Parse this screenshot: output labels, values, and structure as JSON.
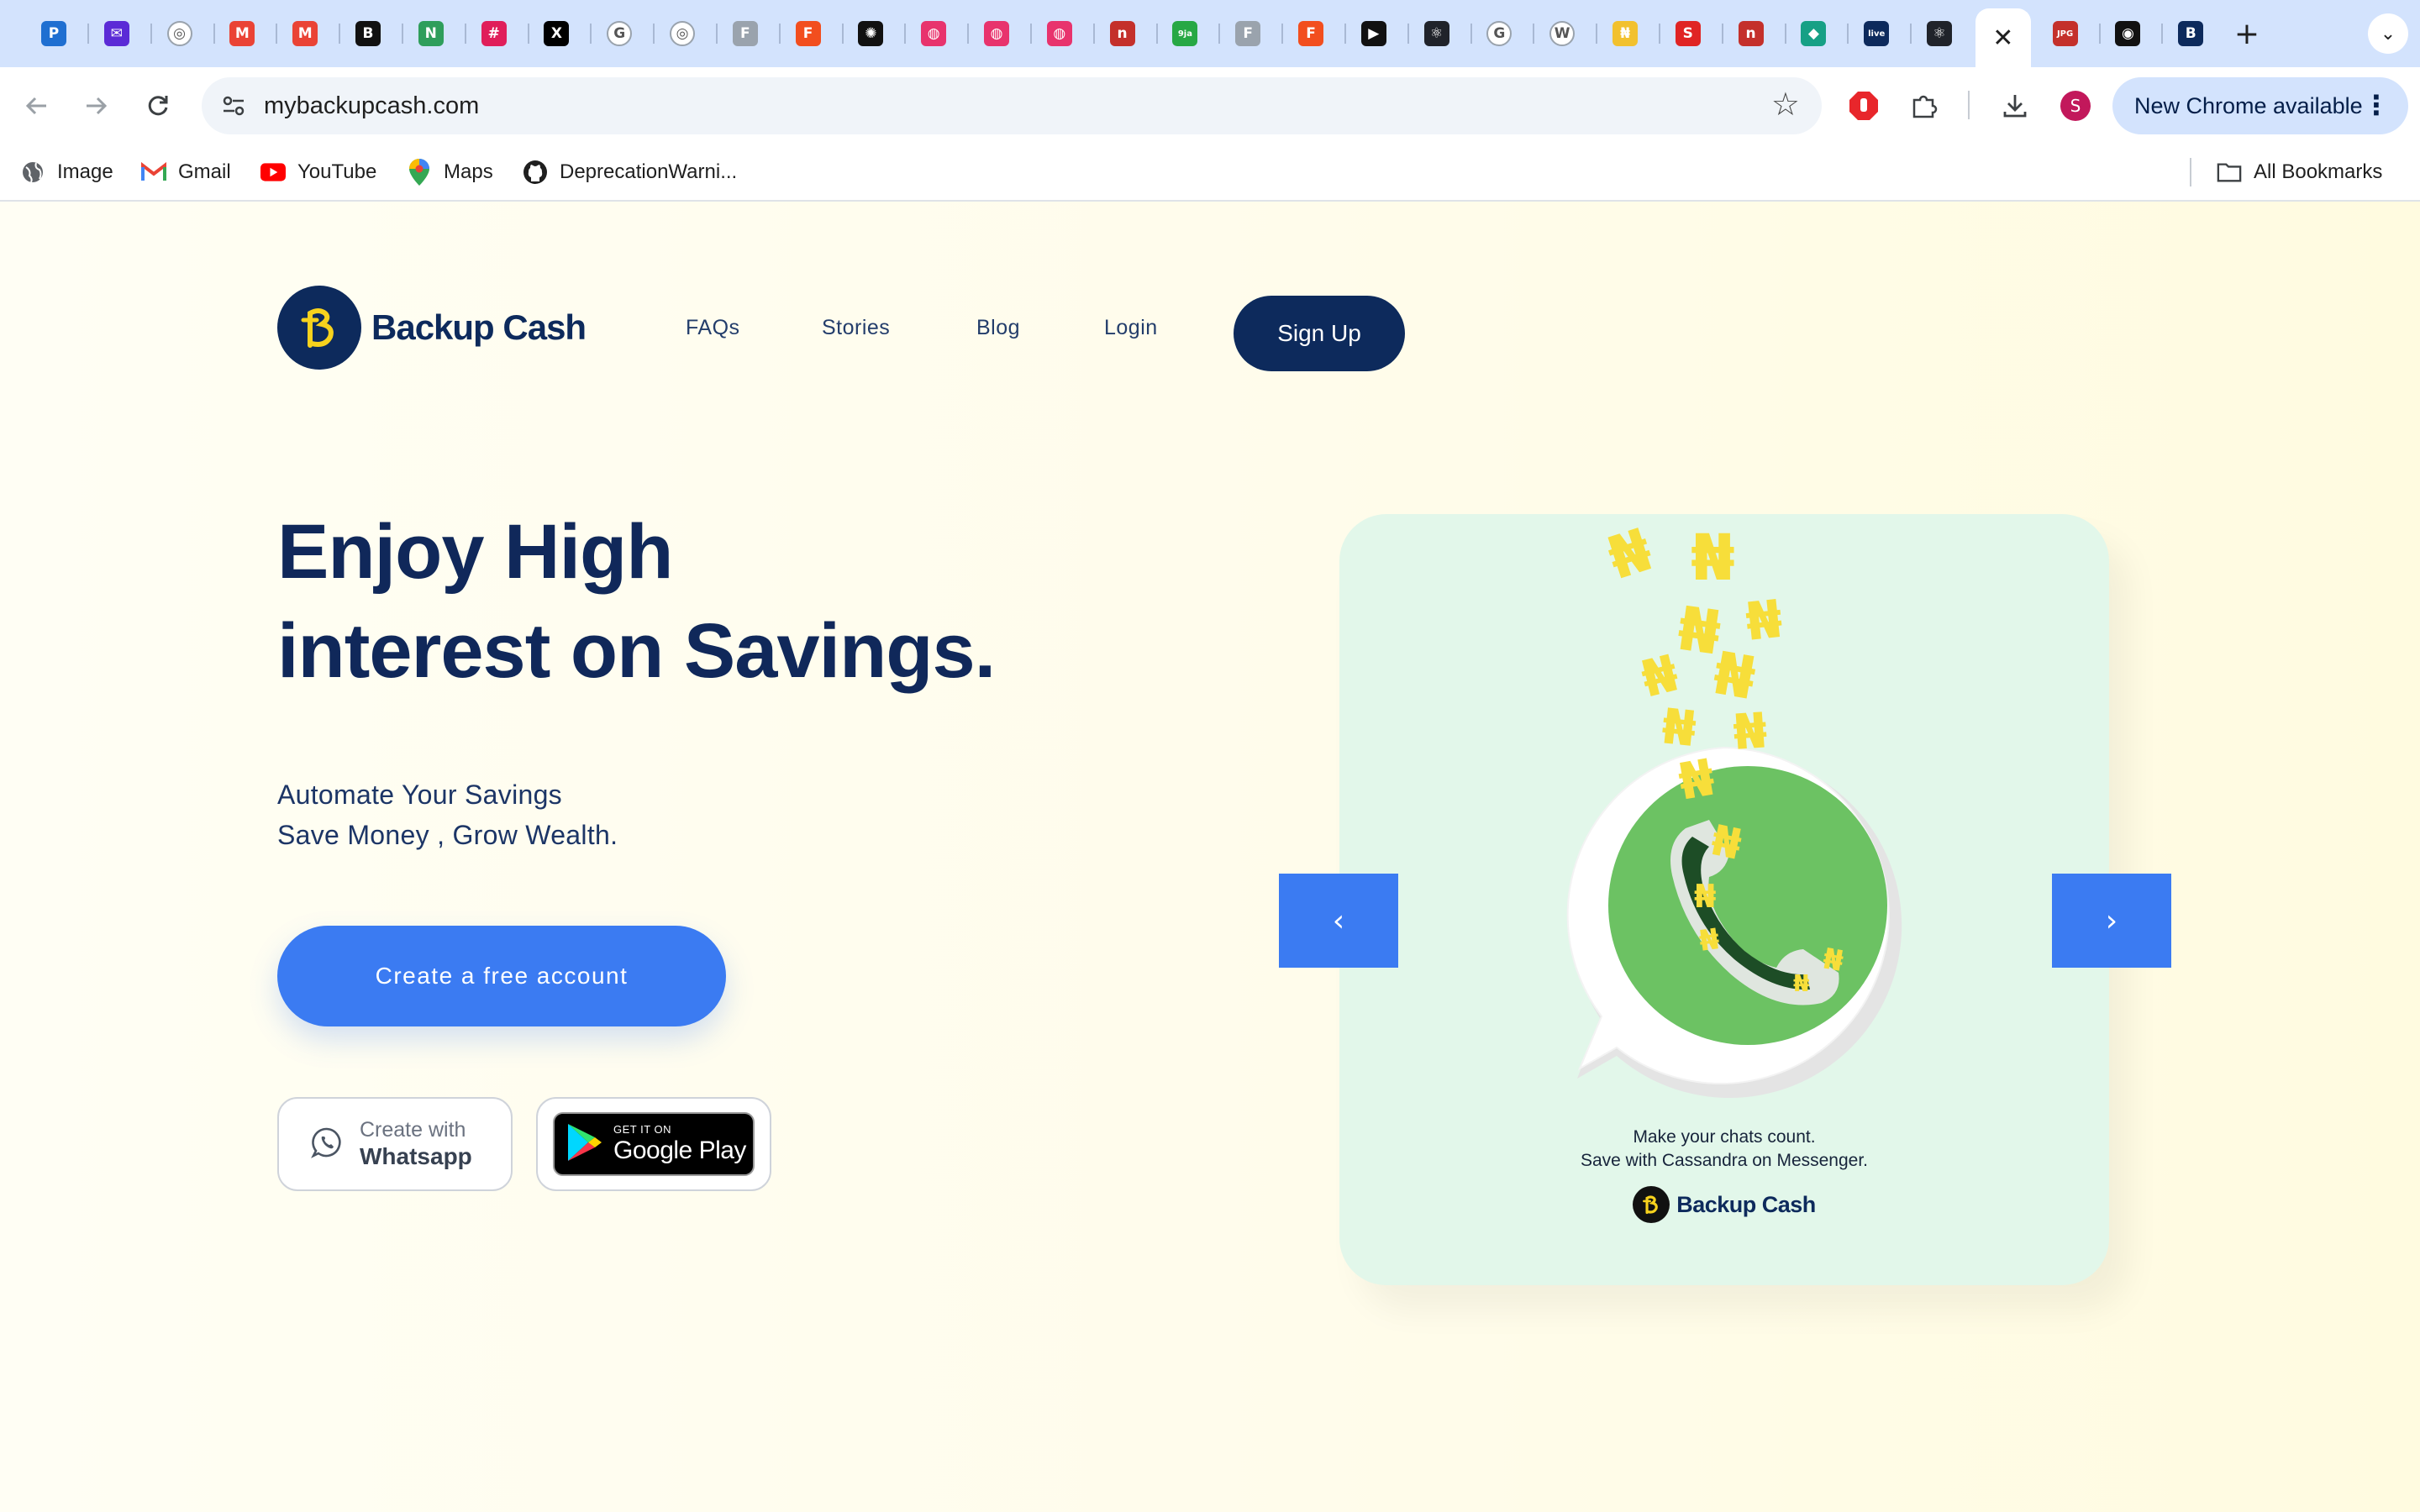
{
  "browser": {
    "tabs": [
      {
        "icon": "pocket-icon",
        "glyph": "P",
        "color": "#1f6fd1"
      },
      {
        "icon": "mail-icon",
        "glyph": "✉",
        "color": "#5b2bd6"
      },
      {
        "icon": "globe-icon",
        "glyph": "◎",
        "color": "#9aa3ad"
      },
      {
        "icon": "gmail-icon",
        "glyph": "M",
        "color": "#ea4335"
      },
      {
        "icon": "gmail-icon",
        "glyph": "M",
        "color": "#ea4335"
      },
      {
        "icon": "b-icon",
        "glyph": "B",
        "color": "#111111"
      },
      {
        "icon": "green-circle-icon",
        "glyph": "N",
        "color": "#2e9e5b"
      },
      {
        "icon": "slack-icon",
        "glyph": "#",
        "color": "#e01e5a"
      },
      {
        "icon": "x-icon",
        "glyph": "X",
        "color": "#000000"
      },
      {
        "icon": "google-icon",
        "glyph": "G",
        "color": "#9aa3ad"
      },
      {
        "icon": "globe-icon",
        "glyph": "◎",
        "color": "#9aa3ad"
      },
      {
        "icon": "figma-icon",
        "glyph": "F",
        "color": "#9aa3ad"
      },
      {
        "icon": "figma-icon",
        "glyph": "F",
        "color": "#f24e1e"
      },
      {
        "icon": "chatgpt-icon",
        "glyph": "✺",
        "color": "#111111"
      },
      {
        "icon": "dribbble-icon",
        "glyph": "◍",
        "color": "#e8336d"
      },
      {
        "icon": "dribbble-icon",
        "glyph": "◍",
        "color": "#e8336d"
      },
      {
        "icon": "dribbble-icon",
        "glyph": "◍",
        "color": "#e8336d"
      },
      {
        "icon": "n-icon",
        "glyph": "n",
        "color": "#c4302b"
      },
      {
        "icon": "naija-icon",
        "glyph": "9ja",
        "color": "#27a844"
      },
      {
        "icon": "figma-icon",
        "glyph": "F",
        "color": "#9aa3ad"
      },
      {
        "icon": "figma-icon",
        "glyph": "F",
        "color": "#f24e1e"
      },
      {
        "icon": "play-icon",
        "glyph": "▶",
        "color": "#111111"
      },
      {
        "icon": "react-icon",
        "glyph": "⚛",
        "color": "#20232a"
      },
      {
        "icon": "google-icon",
        "glyph": "G",
        "color": "#9aa3ad"
      },
      {
        "icon": "wikipedia-icon",
        "glyph": "W",
        "color": "#9aa3ad"
      },
      {
        "icon": "bank-icon",
        "glyph": "₦",
        "color": "#f2c12e"
      },
      {
        "icon": "s-icon",
        "glyph": "S",
        "color": "#e02424"
      },
      {
        "icon": "n-icon",
        "glyph": "n",
        "color": "#c4302b"
      },
      {
        "icon": "diamond-icon",
        "glyph": "◆",
        "color": "#16a085"
      },
      {
        "icon": "live-icon",
        "glyph": "live",
        "color": "#0d2a5c"
      },
      {
        "icon": "react-icon",
        "glyph": "⚛",
        "color": "#20232a"
      },
      {
        "icon": "active-tab-close-icon",
        "glyph": "✕",
        "color": "#ffffff",
        "active": true
      },
      {
        "icon": "jpg-png-icon",
        "glyph": "JPG",
        "color": "#c4302b"
      },
      {
        "icon": "github-icon",
        "glyph": "◉",
        "color": "#111111"
      },
      {
        "icon": "backup-cash-icon",
        "glyph": "B",
        "color": "#0d2a5c"
      }
    ],
    "new_tab": "+",
    "tab_search": "⌄",
    "url": "mybackupcash.com",
    "star": "☆",
    "profile_initial": "S",
    "update_label": "New Chrome available",
    "update_menu": "⋮",
    "bookmarks": [
      {
        "label": "Image",
        "icon": "globe-icon"
      },
      {
        "label": "Gmail",
        "icon": "gmail-icon"
      },
      {
        "label": "YouTube",
        "icon": "youtube-icon"
      },
      {
        "label": "Maps",
        "icon": "maps-icon"
      },
      {
        "label": "DeprecationWarni...",
        "icon": "github-icon"
      }
    ],
    "all_bookmarks": "All Bookmarks"
  },
  "site": {
    "brand": "Backup Cash",
    "nav": [
      "FAQs",
      "Stories",
      "Blog",
      "Login"
    ],
    "signup": "Sign Up",
    "hero_title_line1": "Enjoy High",
    "hero_title_line2": "interest on Savings.",
    "hero_sub_line1": "Automate Your Savings",
    "hero_sub_line2": "Save Money , Grow Wealth.",
    "cta": "Create a free account",
    "whatsapp_small": "Create with",
    "whatsapp_big": "Whatsapp",
    "gplay_small": "GET IT ON",
    "gplay_big": "Google Play"
  },
  "carousel": {
    "caption_line1": "Make your chats count.",
    "caption_line2": "Save with Cassandra on Messenger.",
    "card_brand": "Backup Cash",
    "prev": "‹",
    "next": "›",
    "naira_glyph": "₦",
    "colors": {
      "card": "#e2f7ea",
      "whatsapp_green": "#6cc263",
      "naira_yellow": "#f7de3a",
      "arrow_blue": "#3b7bf2",
      "navy": "#0d2a5c"
    }
  }
}
